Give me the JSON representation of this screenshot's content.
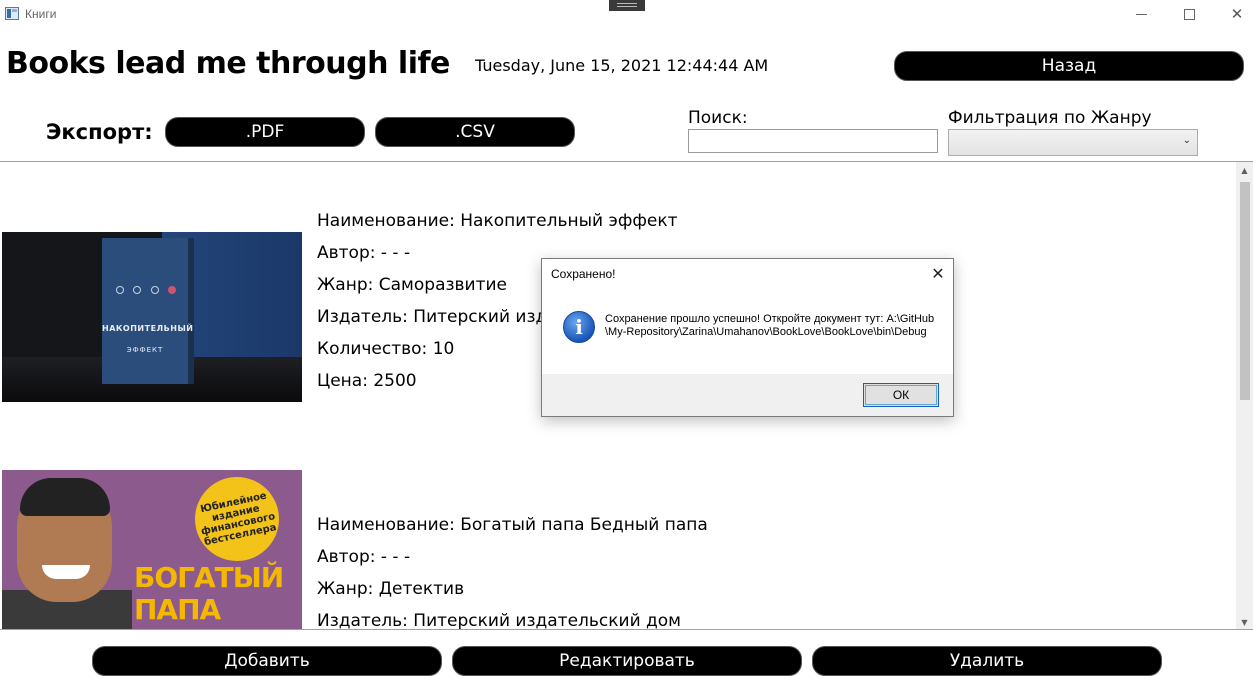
{
  "window": {
    "title": "Книги"
  },
  "header": {
    "heading": "Books lead me through life",
    "datetime": "Tuesday, June 15, 2021 12:44:44 AM",
    "back_label": "Назад"
  },
  "export": {
    "label": "Экспорт:",
    "pdf_label": ".PDF",
    "csv_label": ".CSV"
  },
  "search": {
    "label": "Поиск:",
    "value": ""
  },
  "filter": {
    "label": "Фильтрация по Жанру",
    "selected": ""
  },
  "books": [
    {
      "cover_text": {
        "title": "НАКОПИТЕЛЬНЫЙ",
        "subtitle": "ЭФФЕКТ"
      },
      "name": "Наименование: Накопительный эффект",
      "author": "Автор: - - -",
      "genre": "Жанр: Саморазвитие",
      "publisher": "Издатель: Питерский издательский дом",
      "quantity": "Количество: 10",
      "price": "Цена: 2500"
    },
    {
      "cover_text": {
        "badge": "Юбилейное издание финансового бестселлера",
        "title": "БОГАТЫЙ ПАПА"
      },
      "name": "Наименование: Богатый папа Бедный папа",
      "author": "Автор: - - -",
      "genre": "Жанр: Детектив",
      "publisher": "Издатель: Питерский издательский дом"
    }
  ],
  "actions": {
    "add_label": "Добавить",
    "edit_label": "Редактировать",
    "delete_label": "Удалить"
  },
  "dialog": {
    "title": "Сохранено!",
    "message": "Сохранение прошло успешно! Откройте документ тут: A:\\GitHub\\My-Repository\\Zarina\\Umahanov\\BookLove\\BookLove\\bin\\Debug",
    "ok_label": "ОК",
    "icon": "info-icon"
  },
  "colors": {
    "button_bg": "#000000",
    "button_text": "#ffffff",
    "info_icon": "#1a56b8"
  }
}
